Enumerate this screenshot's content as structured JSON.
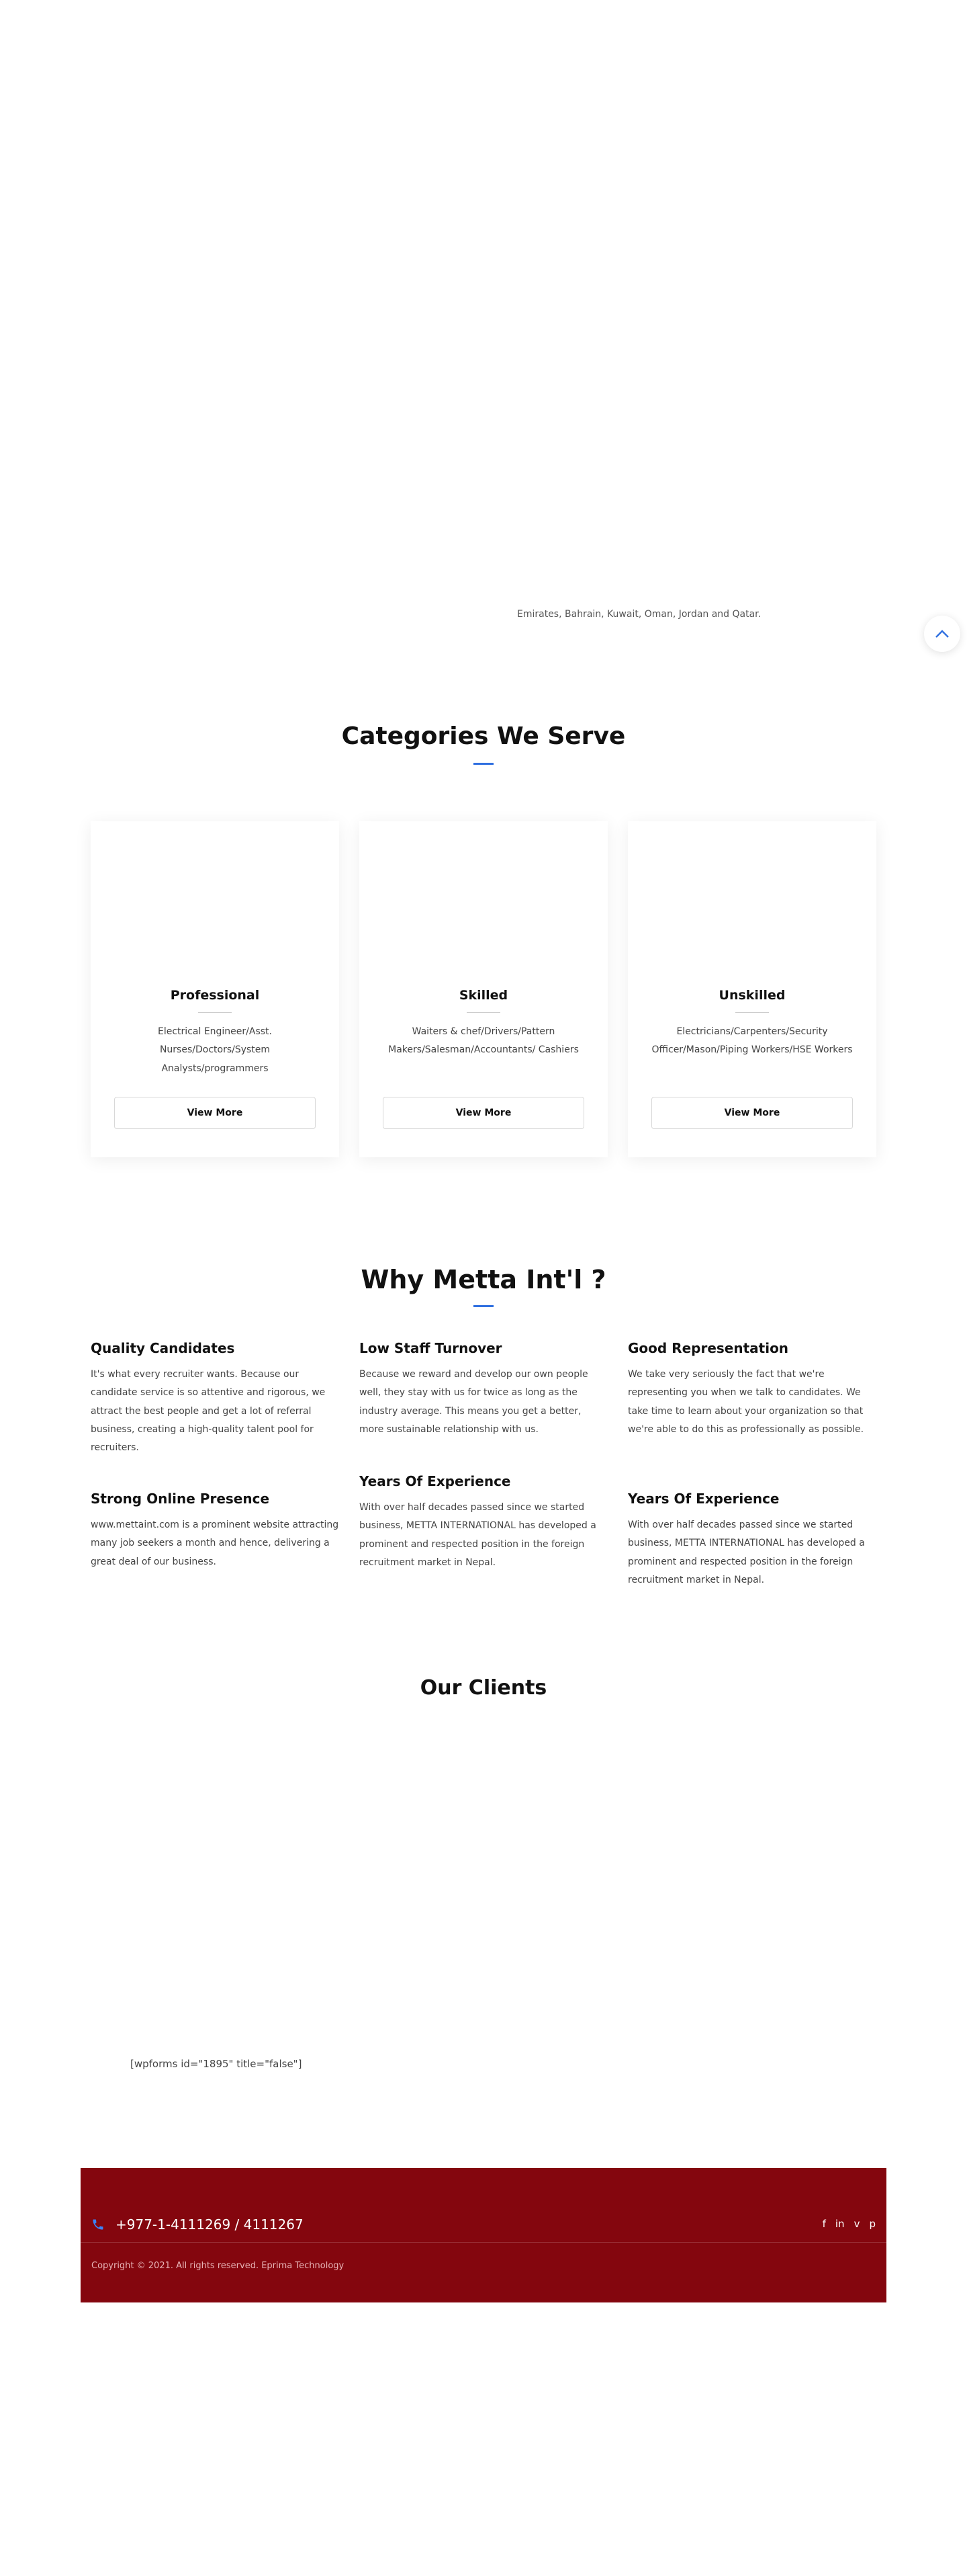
{
  "intro": {
    "text": "Emirates, Bahrain, Kuwait, Oman, Jordan and Qatar."
  },
  "categories": {
    "title": "Categories We Serve",
    "cards": [
      {
        "title": "Professional",
        "description": "Electrical Engineer/Asst. Nurses/Doctors/System Analysts/programmers",
        "button": "View More"
      },
      {
        "title": "Skilled",
        "description": "Waiters & chef/Drivers/Pattern Makers/Salesman/Accountants/ Cashiers",
        "button": "View More"
      },
      {
        "title": "Unskilled",
        "description": "Electricians/Carpenters/Security Officer/Mason/Piping Workers/HSE Workers",
        "button": "View More"
      }
    ]
  },
  "why": {
    "title": "Why Metta Int'l ?",
    "features": [
      {
        "title": "Quality Candidates",
        "text": "It's what every recruiter wants. Because our candidate service is so attentive and rigorous, we attract the best people and get a lot of referral business, creating a high-quality talent pool for recruiters."
      },
      {
        "title": "Low Staff Turnover",
        "text": "Because we reward and develop our own people well, they stay with us for twice as long as the industry average. This means  you get a better, more sustainable relationship with us."
      },
      {
        "title": "Good Representation",
        "text": "We take very seriously the fact that we're representing you when we talk to candidates. We take time to learn about your organization so that we're able to do this as professionally as possible."
      },
      {
        "title": "Strong Online Presence",
        "text": "www.mettaint.com is a prominent website attracting many job seekers a month and hence, delivering a great deal of our business."
      },
      {
        "title": "Years Of Experience",
        "text": "With over half decades passed since we started business, METTA INTERNATIONAL has developed a prominent and respected position in the foreign recruitment market in Nepal."
      },
      {
        "title": "Years Of Experience",
        "text": "With over half decades passed since we started business, METTA INTERNATIONAL has developed a prominent and respected position in the foreign recruitment market in Nepal."
      }
    ]
  },
  "clients": {
    "title": "Our Clients"
  },
  "form": {
    "shortcode": "[wpforms id=\"1895\" title=\"false\"]"
  },
  "footer": {
    "phone": "+977-1-4111269 / 4111267",
    "phone_icon": "phone-icon",
    "social": [
      {
        "icon": "facebook-icon",
        "glyph": "f"
      },
      {
        "icon": "linkedin-icon",
        "glyph": "in"
      },
      {
        "icon": "vimeo-icon",
        "glyph": "v"
      },
      {
        "icon": "pinterest-icon",
        "glyph": "p"
      }
    ],
    "copyright": "Copyright © 2021. All rights reserved. Eprima Technology"
  },
  "colors": {
    "accent": "#2f6fe0",
    "footer_bg": "#84060e"
  }
}
